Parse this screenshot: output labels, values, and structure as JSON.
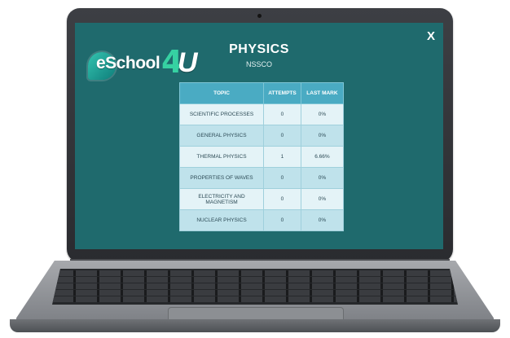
{
  "brand": {
    "logo_text": "eSchool",
    "logo_four": "4",
    "logo_u": "U"
  },
  "window": {
    "close_label": "X"
  },
  "header": {
    "title": "PHYSICS",
    "subtitle": "NSSCO"
  },
  "table": {
    "columns": [
      "TOPIC",
      "ATTEMPTS",
      "LAST MARK"
    ],
    "rows": [
      {
        "topic": "SCIENTIFIC PROCESSES",
        "attempts": "0",
        "last_mark": "0%"
      },
      {
        "topic": "GENERAL PHYSICS",
        "attempts": "0",
        "last_mark": "0%"
      },
      {
        "topic": "THERMAL PHYSICS",
        "attempts": "1",
        "last_mark": "6.66%"
      },
      {
        "topic": "PROPERTIES OF WAVES",
        "attempts": "0",
        "last_mark": "0%"
      },
      {
        "topic": "ELECTRICITY AND MAGNETISM",
        "attempts": "0",
        "last_mark": "0%"
      },
      {
        "topic": "NUCLEAR PHYSICS",
        "attempts": "0",
        "last_mark": "0%"
      }
    ]
  },
  "colors": {
    "screen_bg": "#1f6a6d",
    "table_header": "#4aabc3",
    "row_light": "#e4f3f7",
    "row_dark": "#bfe2eb"
  }
}
